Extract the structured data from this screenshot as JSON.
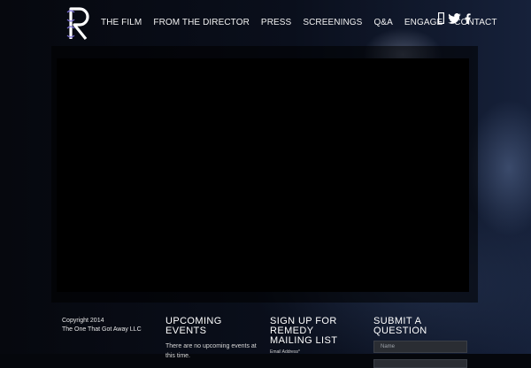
{
  "logo": {
    "letter": "R"
  },
  "nav": {
    "items": [
      {
        "label": "THE FILM"
      },
      {
        "label": "FROM THE DIRECTOR"
      },
      {
        "label": "PRESS"
      },
      {
        "label": "SCREENINGS"
      },
      {
        "label": "Q&A"
      },
      {
        "label": "ENGAGE"
      },
      {
        "label": "CONTACT"
      }
    ]
  },
  "social": {
    "icons": [
      "instagram-icon",
      "twitter-icon",
      "facebook-icon"
    ]
  },
  "footer": {
    "copyright_line1": "Copyright 2014",
    "copyright_line2": "The One That Got Away LLC",
    "events_title": "UPCOMING EVENTS",
    "events_text": "There are no upcoming events at this time.",
    "mailing_title": "SIGN UP FOR REMEDY MAILING LIST",
    "mailing_email_label": "Email Address*",
    "question_title": "SUBMIT A QUESTION",
    "question_name_placeholder": "Name"
  },
  "colors": {
    "background": "#05070c",
    "accent_logo": "#7b6fd6"
  }
}
